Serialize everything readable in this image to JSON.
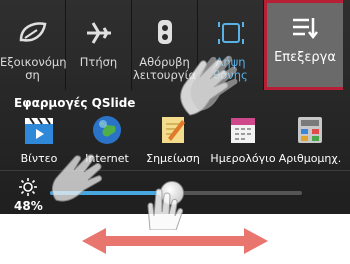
{
  "quick_settings": {
    "tiles": [
      {
        "label": "Εξοικονόμη\nση",
        "icon": "leaf-power-saver-icon"
      },
      {
        "label": "Πτήση",
        "icon": "airplane-icon"
      },
      {
        "label": "Αθόρυβη\nλειτουργία",
        "icon": "silent-mode-icon"
      },
      {
        "label": "Λήψη\nθόνης",
        "icon": "screenshot-icon"
      },
      {
        "label": "Επεξεργα",
        "icon": "edit-settings-icon"
      }
    ]
  },
  "qslide": {
    "title": "Εφαρμογές QSlide",
    "apps": [
      {
        "label": "Βίντεο",
        "icon": "video-clapper-icon"
      },
      {
        "label": "Internet",
        "icon": "globe-icon"
      },
      {
        "label": "Σημείωση",
        "icon": "notepad-pencil-icon"
      },
      {
        "label": "Ημερολόγιο",
        "icon": "calendar-icon"
      },
      {
        "label": "Αριθμομηχ.",
        "icon": "calculator-icon"
      }
    ]
  },
  "brightness": {
    "value_label": "48%",
    "level": 0.48
  },
  "colors": {
    "accent": "#49a7e0",
    "edit_border": "#b61f34",
    "gesture_arrow": "#e8766e"
  }
}
